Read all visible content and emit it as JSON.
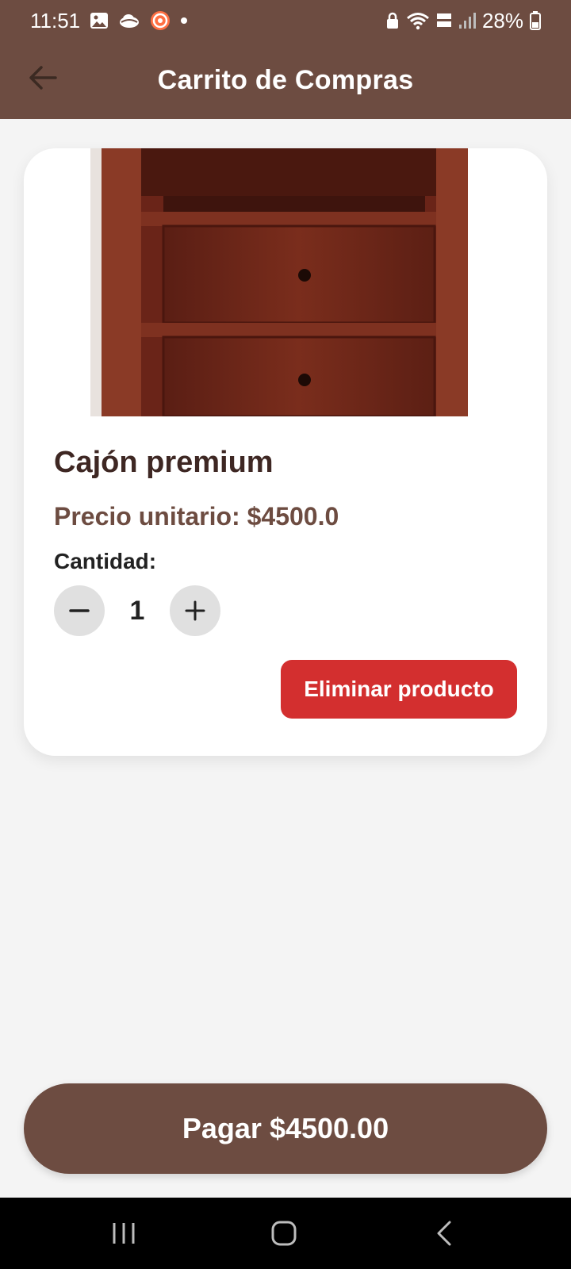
{
  "status_bar": {
    "time": "11:51",
    "battery": "28%",
    "icons": [
      "image-icon",
      "cloud-icon",
      "app-notification-icon",
      "dot-icon",
      "lock-icon",
      "wifi-icon",
      "volte-icon",
      "signal-icon",
      "battery-icon"
    ]
  },
  "header": {
    "title": "Carrito de Compras",
    "back_icon": "arrow-left-icon"
  },
  "cart": {
    "items": [
      {
        "name": "Cajón premium",
        "price_text": "Precio unitario: $4500.0",
        "quantity_label": "Cantidad:",
        "quantity": "1",
        "delete_label": "Eliminar producto"
      }
    ]
  },
  "checkout": {
    "pay_label": "Pagar $4500.00"
  },
  "colors": {
    "primary": "#6d4c41",
    "danger": "#d32f2f",
    "background": "#f4f4f4",
    "title_text": "#3e2723"
  }
}
